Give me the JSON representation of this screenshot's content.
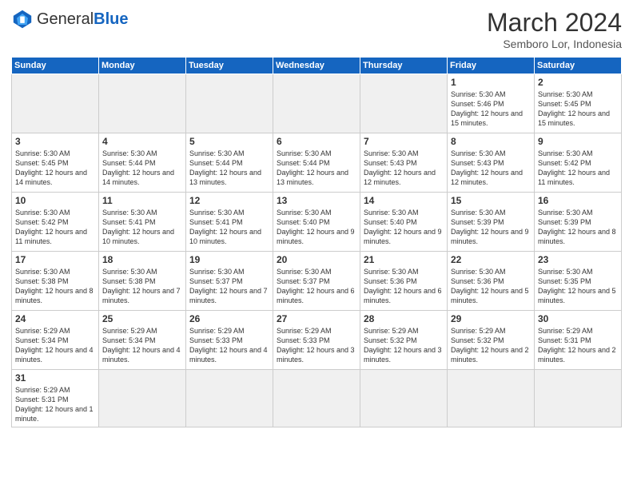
{
  "logo": {
    "text_general": "General",
    "text_blue": "Blue"
  },
  "title": "March 2024",
  "location": "Semboro Lor, Indonesia",
  "days_of_week": [
    "Sunday",
    "Monday",
    "Tuesday",
    "Wednesday",
    "Thursday",
    "Friday",
    "Saturday"
  ],
  "weeks": [
    [
      {
        "day": "",
        "info": "",
        "empty": true
      },
      {
        "day": "",
        "info": "",
        "empty": true
      },
      {
        "day": "",
        "info": "",
        "empty": true
      },
      {
        "day": "",
        "info": "",
        "empty": true
      },
      {
        "day": "",
        "info": "",
        "empty": true
      },
      {
        "day": "1",
        "info": "Sunrise: 5:30 AM\nSunset: 5:46 PM\nDaylight: 12 hours and 15 minutes."
      },
      {
        "day": "2",
        "info": "Sunrise: 5:30 AM\nSunset: 5:45 PM\nDaylight: 12 hours and 15 minutes."
      }
    ],
    [
      {
        "day": "3",
        "info": "Sunrise: 5:30 AM\nSunset: 5:45 PM\nDaylight: 12 hours and 14 minutes."
      },
      {
        "day": "4",
        "info": "Sunrise: 5:30 AM\nSunset: 5:44 PM\nDaylight: 12 hours and 14 minutes."
      },
      {
        "day": "5",
        "info": "Sunrise: 5:30 AM\nSunset: 5:44 PM\nDaylight: 12 hours and 13 minutes."
      },
      {
        "day": "6",
        "info": "Sunrise: 5:30 AM\nSunset: 5:44 PM\nDaylight: 12 hours and 13 minutes."
      },
      {
        "day": "7",
        "info": "Sunrise: 5:30 AM\nSunset: 5:43 PM\nDaylight: 12 hours and 12 minutes."
      },
      {
        "day": "8",
        "info": "Sunrise: 5:30 AM\nSunset: 5:43 PM\nDaylight: 12 hours and 12 minutes."
      },
      {
        "day": "9",
        "info": "Sunrise: 5:30 AM\nSunset: 5:42 PM\nDaylight: 12 hours and 11 minutes."
      }
    ],
    [
      {
        "day": "10",
        "info": "Sunrise: 5:30 AM\nSunset: 5:42 PM\nDaylight: 12 hours and 11 minutes."
      },
      {
        "day": "11",
        "info": "Sunrise: 5:30 AM\nSunset: 5:41 PM\nDaylight: 12 hours and 10 minutes."
      },
      {
        "day": "12",
        "info": "Sunrise: 5:30 AM\nSunset: 5:41 PM\nDaylight: 12 hours and 10 minutes."
      },
      {
        "day": "13",
        "info": "Sunrise: 5:30 AM\nSunset: 5:40 PM\nDaylight: 12 hours and 9 minutes."
      },
      {
        "day": "14",
        "info": "Sunrise: 5:30 AM\nSunset: 5:40 PM\nDaylight: 12 hours and 9 minutes."
      },
      {
        "day": "15",
        "info": "Sunrise: 5:30 AM\nSunset: 5:39 PM\nDaylight: 12 hours and 9 minutes."
      },
      {
        "day": "16",
        "info": "Sunrise: 5:30 AM\nSunset: 5:39 PM\nDaylight: 12 hours and 8 minutes."
      }
    ],
    [
      {
        "day": "17",
        "info": "Sunrise: 5:30 AM\nSunset: 5:38 PM\nDaylight: 12 hours and 8 minutes."
      },
      {
        "day": "18",
        "info": "Sunrise: 5:30 AM\nSunset: 5:38 PM\nDaylight: 12 hours and 7 minutes."
      },
      {
        "day": "19",
        "info": "Sunrise: 5:30 AM\nSunset: 5:37 PM\nDaylight: 12 hours and 7 minutes."
      },
      {
        "day": "20",
        "info": "Sunrise: 5:30 AM\nSunset: 5:37 PM\nDaylight: 12 hours and 6 minutes."
      },
      {
        "day": "21",
        "info": "Sunrise: 5:30 AM\nSunset: 5:36 PM\nDaylight: 12 hours and 6 minutes."
      },
      {
        "day": "22",
        "info": "Sunrise: 5:30 AM\nSunset: 5:36 PM\nDaylight: 12 hours and 5 minutes."
      },
      {
        "day": "23",
        "info": "Sunrise: 5:30 AM\nSunset: 5:35 PM\nDaylight: 12 hours and 5 minutes."
      }
    ],
    [
      {
        "day": "24",
        "info": "Sunrise: 5:29 AM\nSunset: 5:34 PM\nDaylight: 12 hours and 4 minutes."
      },
      {
        "day": "25",
        "info": "Sunrise: 5:29 AM\nSunset: 5:34 PM\nDaylight: 12 hours and 4 minutes."
      },
      {
        "day": "26",
        "info": "Sunrise: 5:29 AM\nSunset: 5:33 PM\nDaylight: 12 hours and 4 minutes."
      },
      {
        "day": "27",
        "info": "Sunrise: 5:29 AM\nSunset: 5:33 PM\nDaylight: 12 hours and 3 minutes."
      },
      {
        "day": "28",
        "info": "Sunrise: 5:29 AM\nSunset: 5:32 PM\nDaylight: 12 hours and 3 minutes."
      },
      {
        "day": "29",
        "info": "Sunrise: 5:29 AM\nSunset: 5:32 PM\nDaylight: 12 hours and 2 minutes."
      },
      {
        "day": "30",
        "info": "Sunrise: 5:29 AM\nSunset: 5:31 PM\nDaylight: 12 hours and 2 minutes."
      }
    ],
    [
      {
        "day": "31",
        "info": "Sunrise: 5:29 AM\nSunset: 5:31 PM\nDaylight: 12 hours and 1 minute.",
        "last": true
      },
      {
        "day": "",
        "info": "",
        "empty": true,
        "last": true
      },
      {
        "day": "",
        "info": "",
        "empty": true,
        "last": true
      },
      {
        "day": "",
        "info": "",
        "empty": true,
        "last": true
      },
      {
        "day": "",
        "info": "",
        "empty": true,
        "last": true
      },
      {
        "day": "",
        "info": "",
        "empty": true,
        "last": true
      },
      {
        "day": "",
        "info": "",
        "empty": true,
        "last": true
      }
    ]
  ]
}
